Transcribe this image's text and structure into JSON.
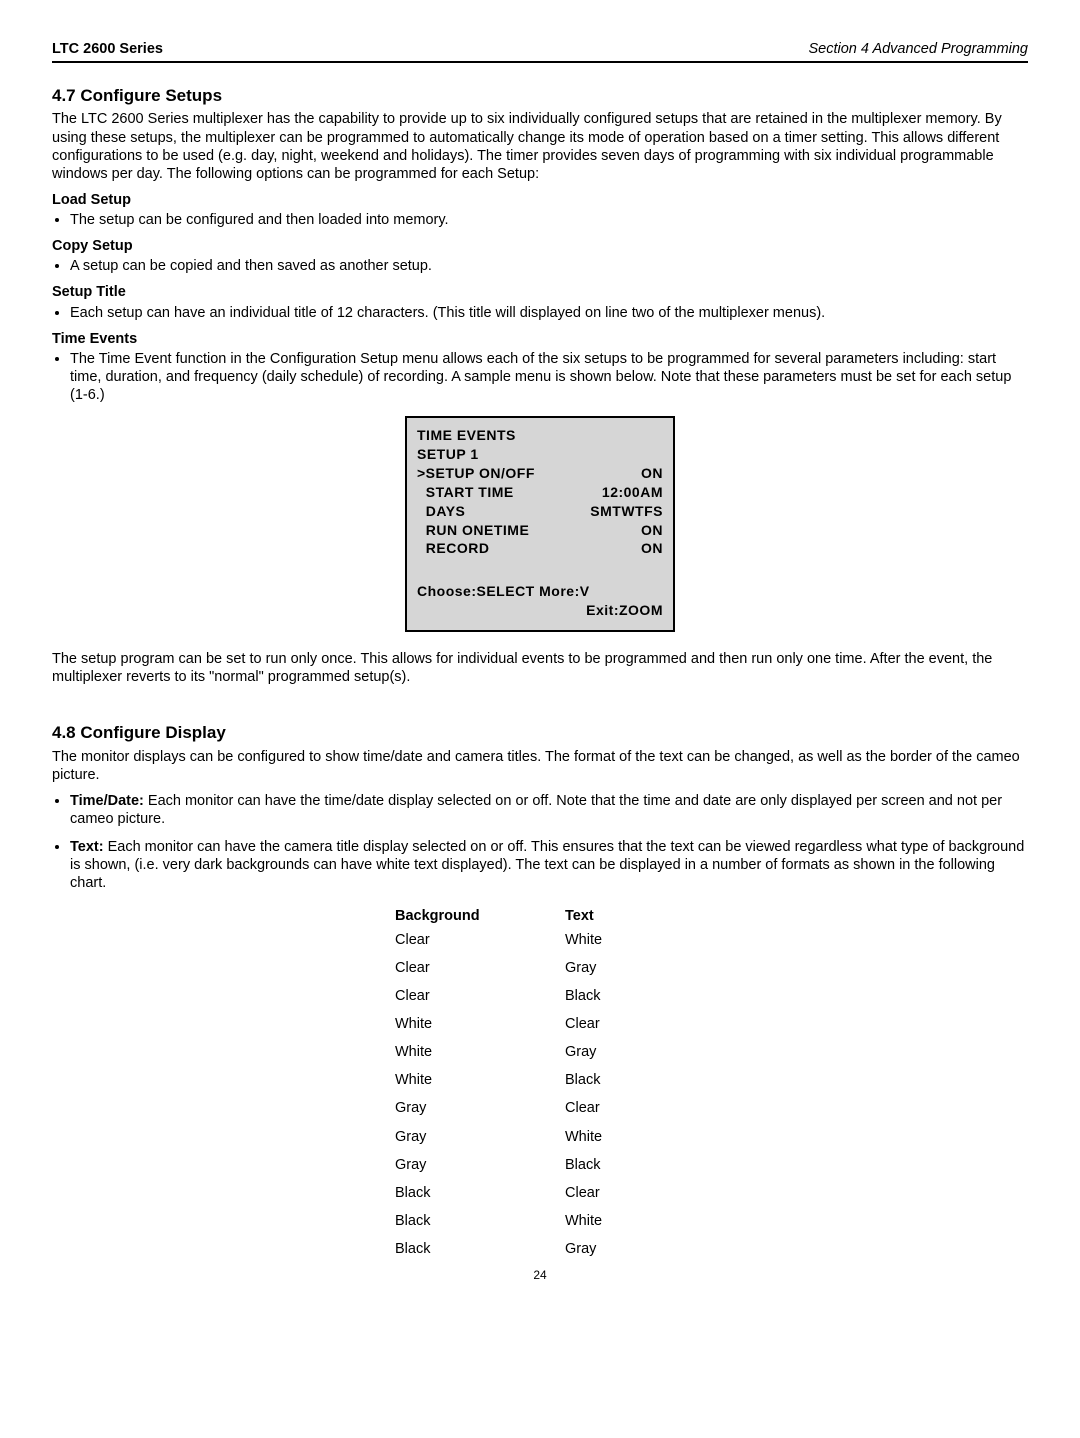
{
  "header": {
    "left": "LTC 2600 Series",
    "right": "Section 4 Advanced Programming"
  },
  "s47": {
    "heading": "4.7 Configure Setups",
    "intro": "The LTC 2600 Series multiplexer has the capability to provide up to six individually configured setups that are retained in the multiplexer memory. By using these setups, the multiplexer can be programmed to automatically change its mode of operation based on a timer setting. This allows different configurations to be used (e.g. day, night, weekend and holidays). The timer provides seven days of programming with six individual programmable windows per day. The following options can be programmed for each Setup:",
    "load": {
      "title": "Load Setup",
      "item": "The setup can be configured and then loaded into memory."
    },
    "copy": {
      "title": "Copy Setup",
      "item": "A setup can be copied and then saved as another setup."
    },
    "title": {
      "title": "Setup Title",
      "item": "Each setup can have an individual title of 12 characters. (This title will displayed on line two of the multiplexer menus)."
    },
    "time": {
      "title": "Time Events",
      "item": "The Time Event function in the Configuration Setup menu allows each of the six setups to be programmed for several parameters including: start time, duration, and frequency (daily schedule) of recording. A sample menu is shown below. Note that these parameters must be set for each setup (1-6.)"
    },
    "menu": {
      "line1": "TIME EVENTS",
      "line2": "SETUP 1",
      "r1l": ">SETUP ON/OFF",
      "r1r": "ON",
      "r2l": "  START TIME",
      "r2r": "12:00AM",
      "r3l": "  DAYS",
      "r3r": "SMTWTFS",
      "r4l": "  RUN ONETIME",
      "r4r": "ON",
      "r5l": "  RECORD",
      "r5r": "ON",
      "f1": "Choose:SELECT   More:V",
      "f2": "Exit:ZOOM"
    },
    "after": "The setup program can be set to run only once. This allows for individual events to be programmed and then run only one time. After the event, the  multiplexer reverts to its \"normal\" programmed setup(s)."
  },
  "s48": {
    "heading": "4.8 Configure Display",
    "intro": "The monitor displays can be configured to show time/date and camera titles. The format of the text can be changed, as well as the border of the cameo picture.",
    "bullet1_bold": "Time/Date:",
    "bullet1_rest": " Each monitor can have the time/date display selected on or off. Note that the time and date are only displayed per screen and not per cameo picture.",
    "bullet2_bold": "Text:",
    "bullet2_rest": " Each monitor can have the camera title display selected on or off. This ensures that the text can be viewed regardless what type of background is shown, (i.e. very dark backgrounds can have white text displayed). The text can be displayed in a number of formats as shown in the following chart.",
    "table": {
      "h1": "Background",
      "h2": "Text",
      "rows": [
        {
          "bg": "Clear",
          "tx": "White"
        },
        {
          "bg": "Clear",
          "tx": "Gray"
        },
        {
          "bg": "Clear",
          "tx": "Black"
        },
        {
          "bg": "White",
          "tx": "Clear"
        },
        {
          "bg": "White",
          "tx": "Gray"
        },
        {
          "bg": "White",
          "tx": "Black"
        },
        {
          "bg": "Gray",
          "tx": "Clear"
        },
        {
          "bg": "Gray",
          "tx": "White"
        },
        {
          "bg": "Gray",
          "tx": "Black"
        },
        {
          "bg": "Black",
          "tx": "Clear"
        },
        {
          "bg": "Black",
          "tx": "White"
        },
        {
          "bg": "Black",
          "tx": "Gray"
        }
      ]
    }
  },
  "page_number": "24"
}
